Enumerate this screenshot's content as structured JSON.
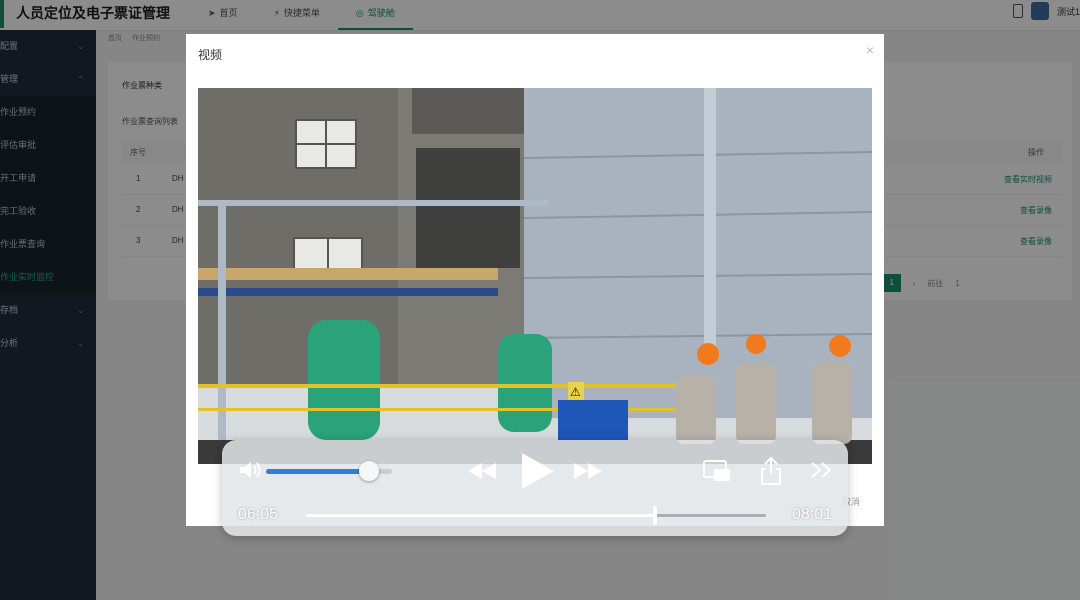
{
  "app": {
    "title": "人员定位及电子票证管理",
    "nav": [
      {
        "label": "首页",
        "icon": "send-icon"
      },
      {
        "label": "快捷菜单",
        "icon": "bolt-icon"
      },
      {
        "label": "驾驶舱",
        "icon": "gauge-icon"
      }
    ],
    "user": "测试1"
  },
  "sidebar": [
    {
      "label": "配置"
    },
    {
      "label": "管理"
    },
    {
      "label": "作业预约"
    },
    {
      "label": "评估审批"
    },
    {
      "label": "开工申请"
    },
    {
      "label": "完工验收"
    },
    {
      "label": "作业票查询"
    },
    {
      "label": "作业实时监控"
    },
    {
      "label": "存档"
    },
    {
      "label": "分析"
    }
  ],
  "breadcrumb": [
    "首页",
    "作业预约"
  ],
  "page": {
    "card_title": "作业票种类",
    "card_subtitle": "作业票查询列表",
    "col_no": "序号",
    "col_op": "操作",
    "rows": [
      {
        "no": "1",
        "code": "DH",
        "op": "查看实时视频"
      },
      {
        "no": "2",
        "code": "DH",
        "op": "查看录像"
      },
      {
        "no": "3",
        "code": "DH",
        "op": "查看录像"
      }
    ],
    "pager": {
      "current": "1",
      "goto": "前往",
      "page": "1"
    }
  },
  "modal": {
    "title": "视频",
    "close": "×",
    "cancel": "取消"
  },
  "player": {
    "current_time": "06:05",
    "total_time": "08:01",
    "progress": 0.758,
    "volume": 0.82,
    "sign_text": "⚠"
  }
}
